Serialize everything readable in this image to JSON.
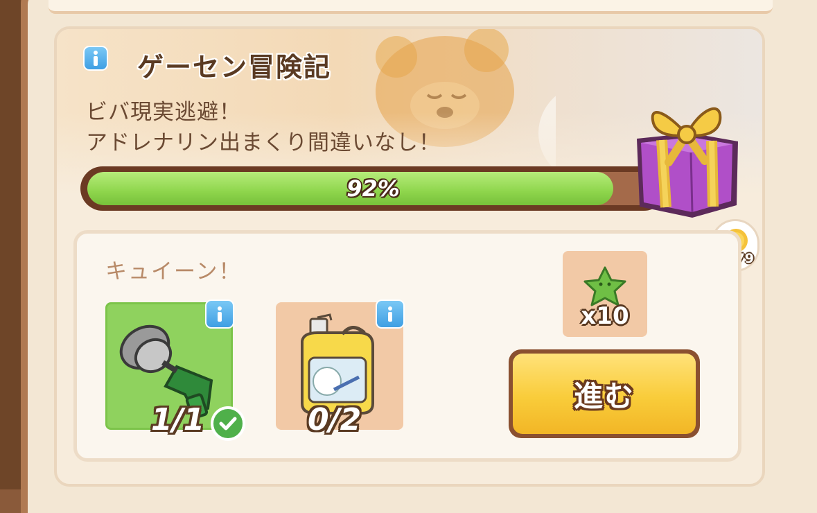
{
  "event": {
    "title": "ゲーセン冒険記",
    "description_line1": "ビバ現実逃避！",
    "description_line2": "アドレナリン出まくり間違いなし！",
    "progress_percent": 92,
    "progress_label": "92%"
  },
  "task": {
    "label": "キュイーン！",
    "items": [
      {
        "icon": "drill-icon",
        "count": "1/1",
        "completed": true
      },
      {
        "icon": "detergent-bottle-icon",
        "count": "0/2",
        "completed": false
      }
    ],
    "reward": {
      "icon": "green-star-icon",
      "count": "x10"
    },
    "go_button_label": "進む"
  },
  "currency": {
    "icon": "sun-coin-icon",
    "count": "x579"
  },
  "colors": {
    "progress_fill": "#8ed54c",
    "button_yellow": "#f9cc3a",
    "info_blue": "#3f9fe3",
    "check_green": "#4fb04a"
  }
}
